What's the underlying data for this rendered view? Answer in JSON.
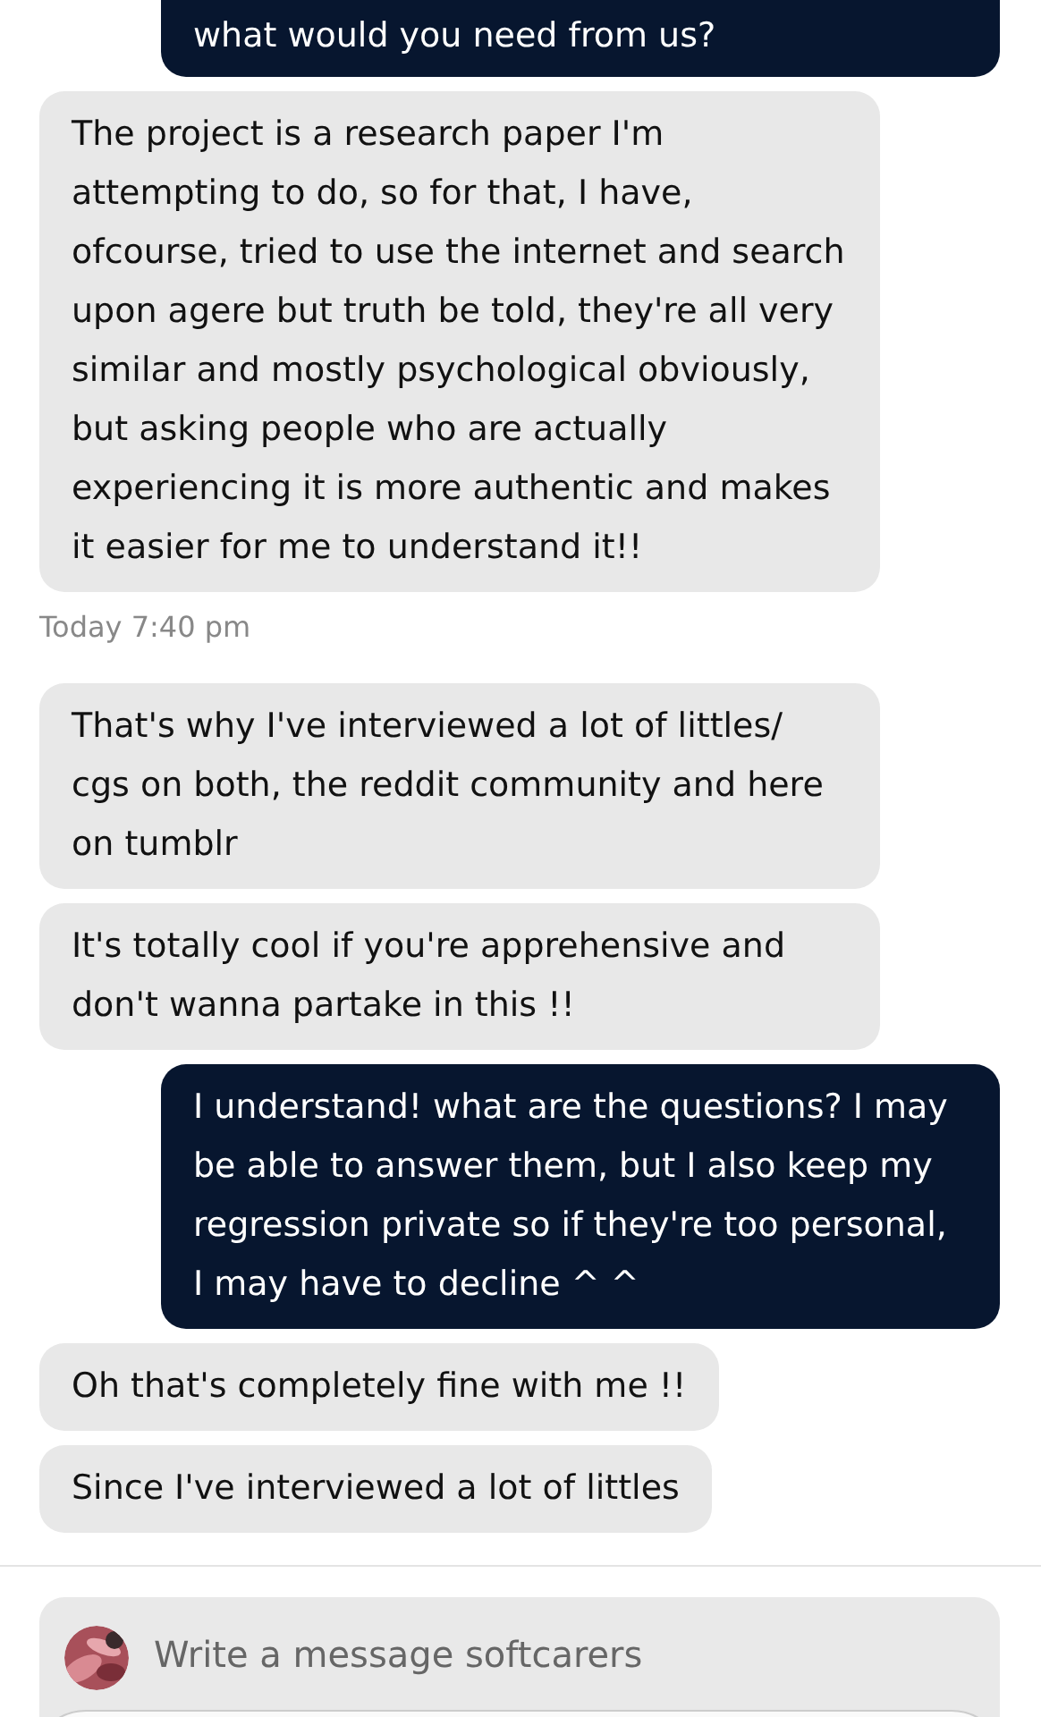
{
  "messages": [
    {
      "kind": "sent",
      "text": "what would you need from us?"
    },
    {
      "kind": "received",
      "text": "The project is a research paper I'm attempting to do, so for that, I have, ofcourse, tried to use the internet and search upon agere but truth be told, they're all very similar and mostly psychological obviously, but asking people who are actually experiencing it is more authentic and makes it easier for me to understand it!!"
    },
    {
      "kind": "timestamp",
      "text": "Today 7:40 pm"
    },
    {
      "kind": "received",
      "text": "That's why I've interviewed a lot of littles/ cgs on both, the reddit community and here on tumblr"
    },
    {
      "kind": "received",
      "text": "It's totally cool if you're apprehensive and don't wanna partake in this !!"
    },
    {
      "kind": "sent",
      "text": "I understand! what are the questions? I may be able to answer them, but I also keep my regression private so if they're too personal, I may have to decline ^ ^"
    },
    {
      "kind": "received",
      "text": "Oh that's completely fine with me !!"
    },
    {
      "kind": "received",
      "text": "Since I've interviewed a lot of littles"
    }
  ],
  "composer": {
    "placeholder": "Write a message softcarers"
  }
}
